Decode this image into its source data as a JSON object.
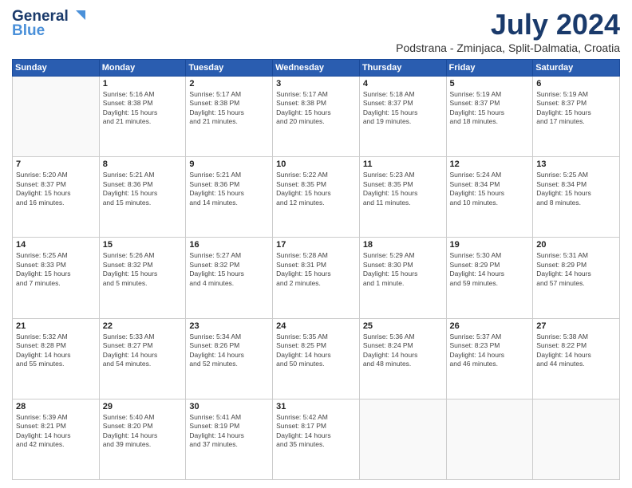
{
  "header": {
    "logo_general": "General",
    "logo_blue": "Blue",
    "title": "July 2024",
    "location": "Podstrana - Zminjaca, Split-Dalmatia, Croatia"
  },
  "days_of_week": [
    "Sunday",
    "Monday",
    "Tuesday",
    "Wednesday",
    "Thursday",
    "Friday",
    "Saturday"
  ],
  "weeks": [
    [
      {
        "num": "",
        "info": ""
      },
      {
        "num": "1",
        "info": "Sunrise: 5:16 AM\nSunset: 8:38 PM\nDaylight: 15 hours\nand 21 minutes."
      },
      {
        "num": "2",
        "info": "Sunrise: 5:17 AM\nSunset: 8:38 PM\nDaylight: 15 hours\nand 21 minutes."
      },
      {
        "num": "3",
        "info": "Sunrise: 5:17 AM\nSunset: 8:38 PM\nDaylight: 15 hours\nand 20 minutes."
      },
      {
        "num": "4",
        "info": "Sunrise: 5:18 AM\nSunset: 8:37 PM\nDaylight: 15 hours\nand 19 minutes."
      },
      {
        "num": "5",
        "info": "Sunrise: 5:19 AM\nSunset: 8:37 PM\nDaylight: 15 hours\nand 18 minutes."
      },
      {
        "num": "6",
        "info": "Sunrise: 5:19 AM\nSunset: 8:37 PM\nDaylight: 15 hours\nand 17 minutes."
      }
    ],
    [
      {
        "num": "7",
        "info": "Sunrise: 5:20 AM\nSunset: 8:37 PM\nDaylight: 15 hours\nand 16 minutes."
      },
      {
        "num": "8",
        "info": "Sunrise: 5:21 AM\nSunset: 8:36 PM\nDaylight: 15 hours\nand 15 minutes."
      },
      {
        "num": "9",
        "info": "Sunrise: 5:21 AM\nSunset: 8:36 PM\nDaylight: 15 hours\nand 14 minutes."
      },
      {
        "num": "10",
        "info": "Sunrise: 5:22 AM\nSunset: 8:35 PM\nDaylight: 15 hours\nand 12 minutes."
      },
      {
        "num": "11",
        "info": "Sunrise: 5:23 AM\nSunset: 8:35 PM\nDaylight: 15 hours\nand 11 minutes."
      },
      {
        "num": "12",
        "info": "Sunrise: 5:24 AM\nSunset: 8:34 PM\nDaylight: 15 hours\nand 10 minutes."
      },
      {
        "num": "13",
        "info": "Sunrise: 5:25 AM\nSunset: 8:34 PM\nDaylight: 15 hours\nand 8 minutes."
      }
    ],
    [
      {
        "num": "14",
        "info": "Sunrise: 5:25 AM\nSunset: 8:33 PM\nDaylight: 15 hours\nand 7 minutes."
      },
      {
        "num": "15",
        "info": "Sunrise: 5:26 AM\nSunset: 8:32 PM\nDaylight: 15 hours\nand 5 minutes."
      },
      {
        "num": "16",
        "info": "Sunrise: 5:27 AM\nSunset: 8:32 PM\nDaylight: 15 hours\nand 4 minutes."
      },
      {
        "num": "17",
        "info": "Sunrise: 5:28 AM\nSunset: 8:31 PM\nDaylight: 15 hours\nand 2 minutes."
      },
      {
        "num": "18",
        "info": "Sunrise: 5:29 AM\nSunset: 8:30 PM\nDaylight: 15 hours\nand 1 minute."
      },
      {
        "num": "19",
        "info": "Sunrise: 5:30 AM\nSunset: 8:29 PM\nDaylight: 14 hours\nand 59 minutes."
      },
      {
        "num": "20",
        "info": "Sunrise: 5:31 AM\nSunset: 8:29 PM\nDaylight: 14 hours\nand 57 minutes."
      }
    ],
    [
      {
        "num": "21",
        "info": "Sunrise: 5:32 AM\nSunset: 8:28 PM\nDaylight: 14 hours\nand 55 minutes."
      },
      {
        "num": "22",
        "info": "Sunrise: 5:33 AM\nSunset: 8:27 PM\nDaylight: 14 hours\nand 54 minutes."
      },
      {
        "num": "23",
        "info": "Sunrise: 5:34 AM\nSunset: 8:26 PM\nDaylight: 14 hours\nand 52 minutes."
      },
      {
        "num": "24",
        "info": "Sunrise: 5:35 AM\nSunset: 8:25 PM\nDaylight: 14 hours\nand 50 minutes."
      },
      {
        "num": "25",
        "info": "Sunrise: 5:36 AM\nSunset: 8:24 PM\nDaylight: 14 hours\nand 48 minutes."
      },
      {
        "num": "26",
        "info": "Sunrise: 5:37 AM\nSunset: 8:23 PM\nDaylight: 14 hours\nand 46 minutes."
      },
      {
        "num": "27",
        "info": "Sunrise: 5:38 AM\nSunset: 8:22 PM\nDaylight: 14 hours\nand 44 minutes."
      }
    ],
    [
      {
        "num": "28",
        "info": "Sunrise: 5:39 AM\nSunset: 8:21 PM\nDaylight: 14 hours\nand 42 minutes."
      },
      {
        "num": "29",
        "info": "Sunrise: 5:40 AM\nSunset: 8:20 PM\nDaylight: 14 hours\nand 39 minutes."
      },
      {
        "num": "30",
        "info": "Sunrise: 5:41 AM\nSunset: 8:19 PM\nDaylight: 14 hours\nand 37 minutes."
      },
      {
        "num": "31",
        "info": "Sunrise: 5:42 AM\nSunset: 8:17 PM\nDaylight: 14 hours\nand 35 minutes."
      },
      {
        "num": "",
        "info": ""
      },
      {
        "num": "",
        "info": ""
      },
      {
        "num": "",
        "info": ""
      }
    ]
  ]
}
